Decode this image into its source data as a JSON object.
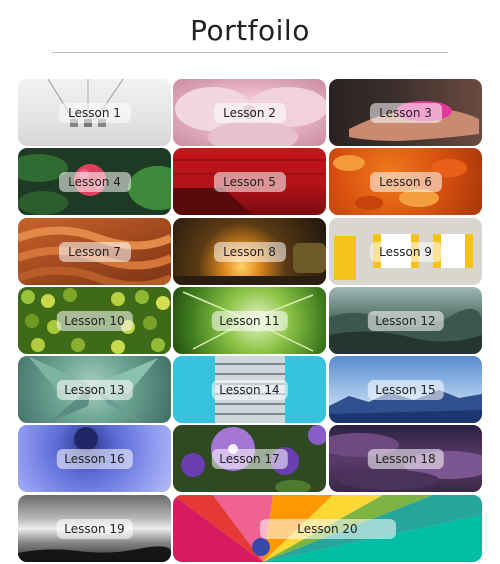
{
  "page": {
    "title": "Portfoilo"
  },
  "lessons": [
    {
      "label": "Lesson 1"
    },
    {
      "label": "Lesson 2"
    },
    {
      "label": "Lesson 3"
    },
    {
      "label": "Lesson 4"
    },
    {
      "label": "Lesson 5"
    },
    {
      "label": "Lesson 6"
    },
    {
      "label": "Lesson 7"
    },
    {
      "label": "Lesson 8"
    },
    {
      "label": "Lesson 9"
    },
    {
      "label": "Lesson 10"
    },
    {
      "label": "Lesson 11"
    },
    {
      "label": "Lesson 12"
    },
    {
      "label": "Lesson 13"
    },
    {
      "label": "Lesson 14"
    },
    {
      "label": "Lesson 15"
    },
    {
      "label": "Lesson 16"
    },
    {
      "label": "Lesson 17"
    },
    {
      "label": "Lesson 18"
    },
    {
      "label": "Lesson 19"
    },
    {
      "label": "Lesson 20"
    }
  ]
}
